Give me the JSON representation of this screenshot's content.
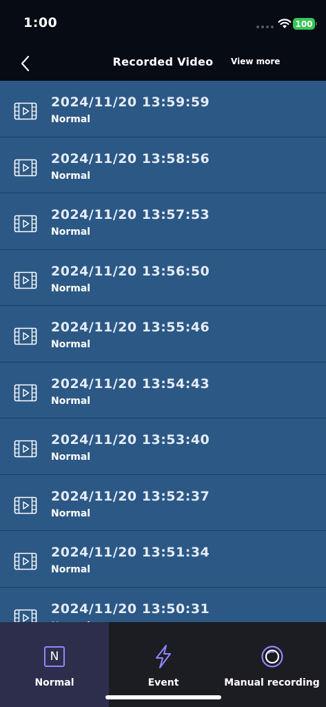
{
  "status": {
    "time": "1:00",
    "battery": "100"
  },
  "nav": {
    "title": "Recorded Video",
    "view_more": "View more"
  },
  "videos": [
    {
      "datetime": "2024/11/20 13:59:59",
      "type": "Normal"
    },
    {
      "datetime": "2024/11/20 13:58:56",
      "type": "Normal"
    },
    {
      "datetime": "2024/11/20 13:57:53",
      "type": "Normal"
    },
    {
      "datetime": "2024/11/20 13:56:50",
      "type": "Normal"
    },
    {
      "datetime": "2024/11/20 13:55:46",
      "type": "Normal"
    },
    {
      "datetime": "2024/11/20 13:54:43",
      "type": "Normal"
    },
    {
      "datetime": "2024/11/20 13:53:40",
      "type": "Normal"
    },
    {
      "datetime": "2024/11/20 13:52:37",
      "type": "Normal"
    },
    {
      "datetime": "2024/11/20 13:51:34",
      "type": "Normal"
    },
    {
      "datetime": "2024/11/20 13:50:31",
      "type": "Normal"
    }
  ],
  "tabs": [
    {
      "label": "Normal",
      "icon": "normal-n-icon",
      "active": true
    },
    {
      "label": "Event",
      "icon": "lightning-icon",
      "active": false
    },
    {
      "label": "Manual recording",
      "icon": "record-circle-icon",
      "active": false
    }
  ],
  "colors": {
    "background": "#070b14",
    "list_row": "#2c5885",
    "row_divider": "#1d3d61",
    "tab_bar": "#1c1c23",
    "tab_active": "#2d2e4c",
    "accent": "#8f88ff",
    "battery": "#35c759"
  }
}
